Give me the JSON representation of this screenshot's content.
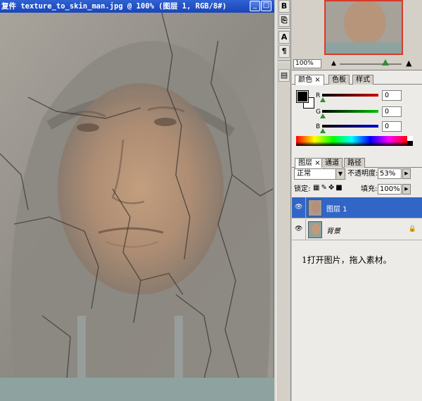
{
  "document": {
    "title": "复件 texture_to_skin_man.jpg @ 100% (图层 1, RGB/8#)",
    "minimize_glyph": "_",
    "maximize_glyph": "□"
  },
  "tool_strip": {
    "icons": [
      "brush-presets-icon",
      "clone-source-icon",
      "character-icon",
      "paragraph-icon",
      "layer-comps-icon"
    ]
  },
  "navigator": {
    "zoom": "100%"
  },
  "color_panel": {
    "tabs": [
      "颜色",
      "色板",
      "样式"
    ],
    "channels": [
      {
        "label": "R",
        "value": "0",
        "color": "#c00000"
      },
      {
        "label": "G",
        "value": "0",
        "color": "#00a000"
      },
      {
        "label": "B",
        "value": "0",
        "color": "#0000c0"
      }
    ],
    "foreground": "#000000",
    "background": "#ffffff"
  },
  "layers_panel": {
    "tabs": [
      "图层",
      "通道",
      "路径"
    ],
    "blend_mode": "正常",
    "opacity_label": "不透明度:",
    "opacity_value": "53%",
    "lock_label": "锁定:",
    "fill_label": "填充:",
    "fill_value": "100%",
    "layers": [
      {
        "name": "图层 1",
        "selected": true
      },
      {
        "name": "背景",
        "selected": false
      }
    ]
  },
  "note": "1打开图片，拖入素材。"
}
